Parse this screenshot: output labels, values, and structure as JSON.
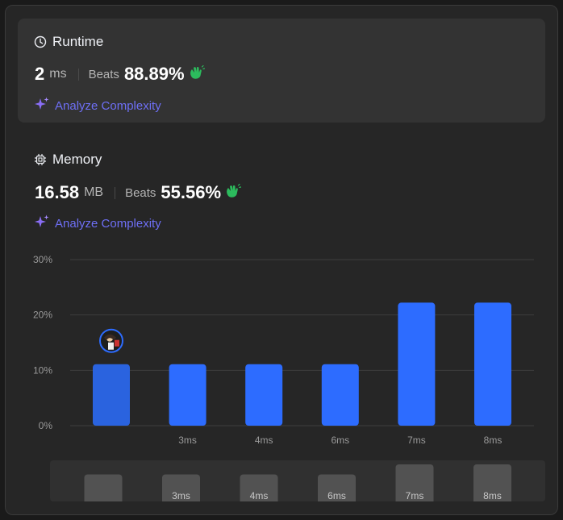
{
  "runtime": {
    "title": "Runtime",
    "value": "2",
    "unit": "ms",
    "beats_label": "Beats",
    "beats_pct": "88.89%",
    "analyze_label": "Analyze Complexity"
  },
  "memory": {
    "title": "Memory",
    "value": "16.58",
    "unit": "MB",
    "beats_label": "Beats",
    "beats_pct": "55.56%",
    "analyze_label": "Analyze Complexity"
  },
  "colors": {
    "bar": "#2d6cff",
    "bar_user": "#2a63df",
    "accent_green": "#2cbb5d",
    "link_purple": "#6e6ff5"
  },
  "chart_data": {
    "type": "bar",
    "categories": [
      "",
      "3ms",
      "4ms",
      "6ms",
      "7ms",
      "8ms"
    ],
    "values": [
      11.11,
      11.11,
      11.11,
      11.11,
      22.22,
      22.22
    ],
    "y_ticks": [
      "30%",
      "20%",
      "10%",
      "0%"
    ],
    "ylim": [
      0,
      30
    ],
    "grid": true,
    "user_bar_index": 0,
    "overview_labels": [
      "",
      "3ms",
      "4ms",
      "6ms",
      "7ms",
      "8ms"
    ]
  }
}
